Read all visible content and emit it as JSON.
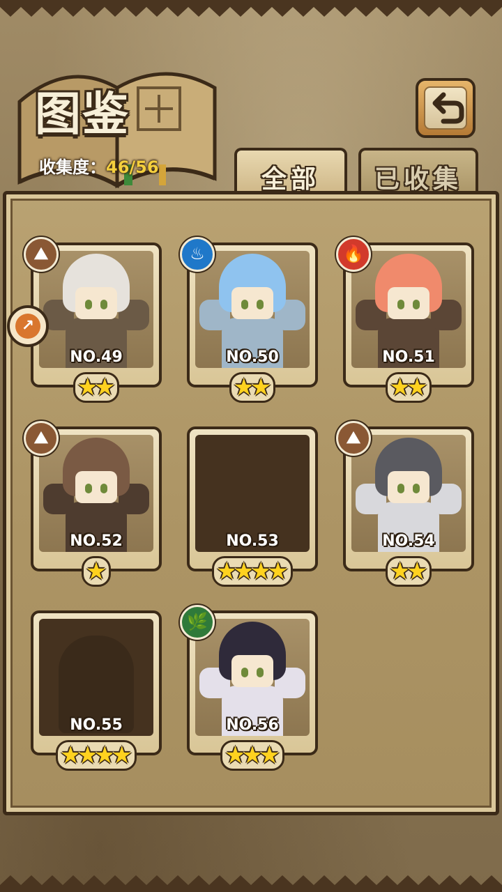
{
  "header": {
    "title": "图鉴",
    "progress_label": "收集度：",
    "progress_value": "46/56"
  },
  "tabs": [
    {
      "label": "全部",
      "active": true
    },
    {
      "label": "已收集",
      "active": false
    }
  ],
  "icons": {
    "back": "back-arrow-icon",
    "unlock": "pointer-arrow-icon"
  },
  "cards": [
    {
      "number": "NO.49",
      "stars": 2,
      "element": "earth",
      "locked": false,
      "hair_color": "#e6e2dc",
      "body_color": "#6b5a46"
    },
    {
      "number": "NO.50",
      "stars": 2,
      "element": "water",
      "locked": false,
      "hair_color": "#8fc3ef",
      "body_color": "#9fb6c8"
    },
    {
      "number": "NO.51",
      "stars": 2,
      "element": "fire",
      "locked": false,
      "hair_color": "#f08a6c",
      "body_color": "#5b4636"
    },
    {
      "number": "NO.52",
      "stars": 1,
      "element": "earth",
      "locked": false,
      "hair_color": "#7a5a44",
      "body_color": "#4e3c2f"
    },
    {
      "number": "NO.53",
      "stars": 4,
      "element": "",
      "locked": true
    },
    {
      "number": "NO.54",
      "stars": 2,
      "element": "earth",
      "locked": false,
      "hair_color": "#5a5a60",
      "body_color": "#d8d8dc"
    },
    {
      "number": "NO.55",
      "stars": 4,
      "element": "",
      "locked": true
    },
    {
      "number": "NO.56",
      "stars": 3,
      "element": "grass",
      "locked": false,
      "hair_color": "#2f2a3a",
      "body_color": "#e4e0ea"
    }
  ],
  "element_icons": {
    "earth": "⛰",
    "water": "♨",
    "fire": "🔥",
    "grass": "🌿"
  }
}
